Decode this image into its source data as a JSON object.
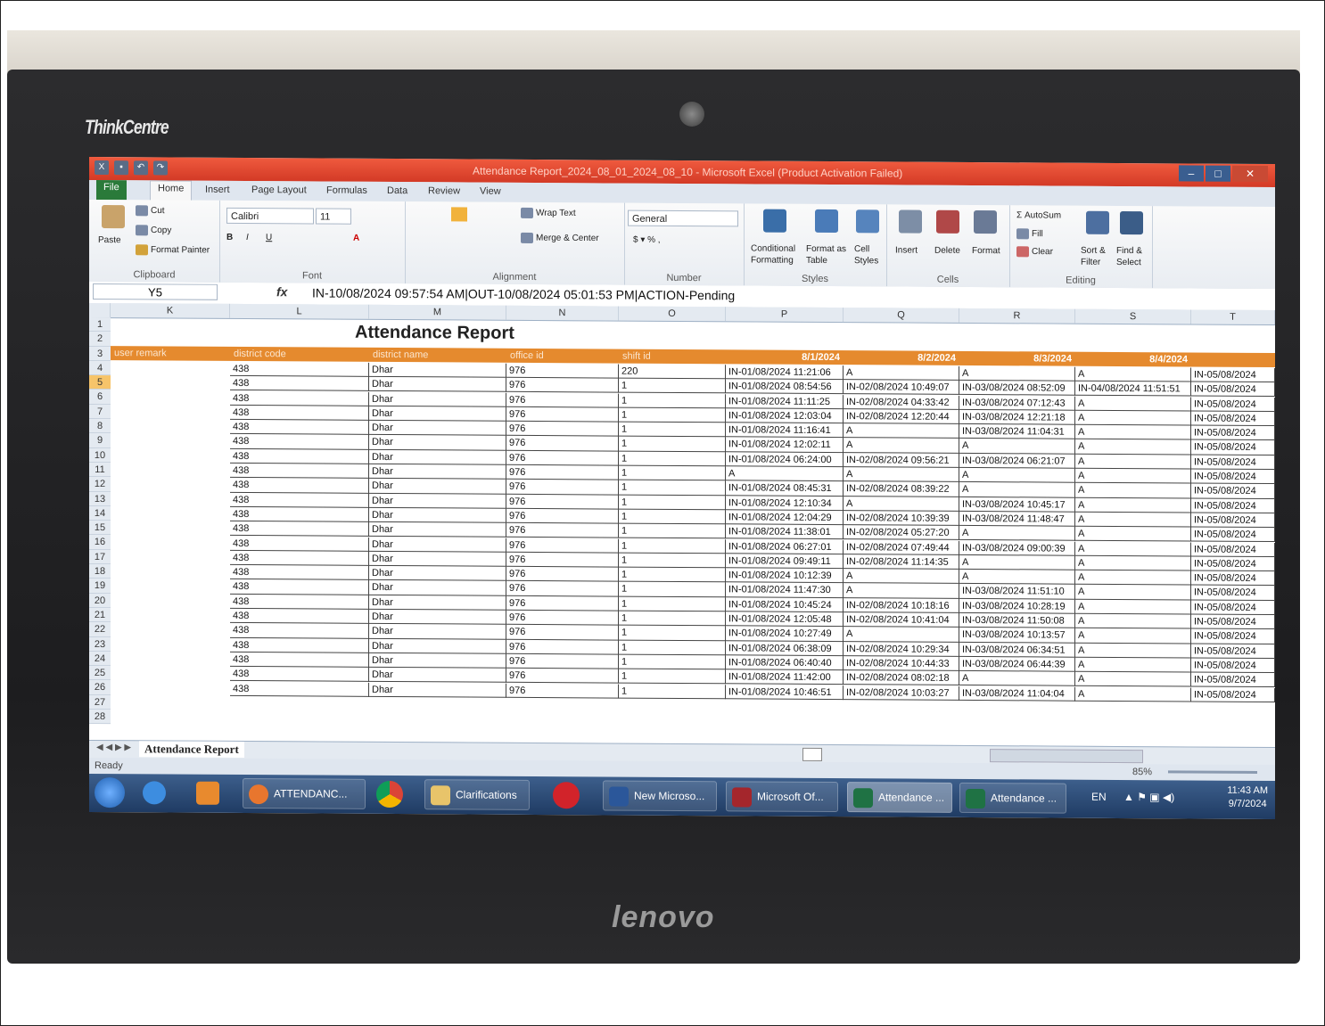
{
  "monitor": {
    "brand_top": "ThinkCentre",
    "brand_bottom": "lenovo"
  },
  "window": {
    "title": "Attendance Report_2024_08_01_2024_08_10 - Microsoft Excel (Product Activation Failed)"
  },
  "ribbon": {
    "tabs": [
      "File",
      "Home",
      "Insert",
      "Page Layout",
      "Formulas",
      "Data",
      "Review",
      "View"
    ],
    "clipboard": {
      "paste": "Paste",
      "cut": "Cut",
      "copy": "Copy",
      "format_painter": "Format Painter",
      "label": "Clipboard"
    },
    "font": {
      "name": "Calibri",
      "size": "11",
      "label": "Font"
    },
    "alignment": {
      "wrap_text": "Wrap Text",
      "merge_center": "Merge & Center",
      "label": "Alignment"
    },
    "number": {
      "format": "General",
      "label": "Number"
    },
    "styles": {
      "conditional": "Conditional",
      "formatting": "Formatting",
      "format_as": "Format as",
      "table": "Table",
      "cell": "Cell",
      "cell_styles": "Styles",
      "label": "Styles"
    },
    "cells": {
      "insert": "Insert",
      "delete": "Delete",
      "format": "Format",
      "label": "Cells"
    },
    "editing": {
      "autosum": "AutoSum",
      "fill": "Fill",
      "clear": "Clear",
      "sort": "Sort &",
      "filter": "Filter",
      "find": "Find &",
      "select": "Select",
      "label": "Editing"
    }
  },
  "formula_bar": {
    "name_box": "Y5",
    "fx": "fx",
    "value": "IN-10/08/2024 09:57:54 AM|OUT-10/08/2024 05:01:53 PM|ACTION-Pending"
  },
  "sheet": {
    "column_letters": [
      "K",
      "L",
      "M",
      "N",
      "O",
      "P",
      "Q",
      "R",
      "S",
      "T"
    ],
    "row_numbers": [
      "1",
      "2",
      "3",
      "4",
      "5",
      "6",
      "7",
      "8",
      "9",
      "10",
      "11",
      "12",
      "13",
      "14",
      "15",
      "16",
      "17",
      "18",
      "19",
      "20",
      "21",
      "22",
      "23",
      "24",
      "25",
      "26",
      "27",
      "28"
    ],
    "title": "Attendance Report",
    "headers": [
      "user remark",
      "district code",
      "district name",
      "office id",
      "shift id",
      "8/1/2024",
      "8/2/2024",
      "8/3/2024",
      "8/4/2024"
    ],
    "rows": [
      [
        "",
        "438",
        "Dhar",
        "976",
        "220",
        "IN-01/08/2024 11:21:06",
        "A",
        "A",
        "A",
        "IN-05/08/2024"
      ],
      [
        "",
        "438",
        "Dhar",
        "976",
        "1",
        "IN-01/08/2024 08:54:56",
        "IN-02/08/2024 10:49:07",
        "IN-03/08/2024 08:52:09",
        "IN-04/08/2024 11:51:51",
        "IN-05/08/2024"
      ],
      [
        "",
        "438",
        "Dhar",
        "976",
        "1",
        "IN-01/08/2024 11:11:25",
        "IN-02/08/2024 04:33:42",
        "IN-03/08/2024 07:12:43",
        "A",
        "IN-05/08/2024"
      ],
      [
        "",
        "438",
        "Dhar",
        "976",
        "1",
        "IN-01/08/2024 12:03:04",
        "IN-02/08/2024 12:20:44",
        "IN-03/08/2024 12:21:18",
        "A",
        "IN-05/08/2024"
      ],
      [
        "",
        "438",
        "Dhar",
        "976",
        "1",
        "IN-01/08/2024 11:16:41",
        "A",
        "IN-03/08/2024 11:04:31",
        "A",
        "IN-05/08/2024"
      ],
      [
        "",
        "438",
        "Dhar",
        "976",
        "1",
        "IN-01/08/2024 12:02:11",
        "A",
        "A",
        "A",
        "IN-05/08/2024"
      ],
      [
        "",
        "438",
        "Dhar",
        "976",
        "1",
        "IN-01/08/2024 06:24:00",
        "IN-02/08/2024 09:56:21",
        "IN-03/08/2024 06:21:07",
        "A",
        "IN-05/08/2024"
      ],
      [
        "",
        "438",
        "Dhar",
        "976",
        "1",
        "A",
        "A",
        "A",
        "A",
        "IN-05/08/2024"
      ],
      [
        "",
        "438",
        "Dhar",
        "976",
        "1",
        "IN-01/08/2024 08:45:31",
        "IN-02/08/2024 08:39:22",
        "A",
        "A",
        "IN-05/08/2024"
      ],
      [
        "",
        "438",
        "Dhar",
        "976",
        "1",
        "IN-01/08/2024 12:10:34",
        "A",
        "IN-03/08/2024 10:45:17",
        "A",
        "IN-05/08/2024"
      ],
      [
        "",
        "438",
        "Dhar",
        "976",
        "1",
        "IN-01/08/2024 12:04:29",
        "IN-02/08/2024 10:39:39",
        "IN-03/08/2024 11:48:47",
        "A",
        "IN-05/08/2024"
      ],
      [
        "",
        "438",
        "Dhar",
        "976",
        "1",
        "IN-01/08/2024 11:38:01",
        "IN-02/08/2024 05:27:20",
        "A",
        "A",
        "IN-05/08/2024"
      ],
      [
        "",
        "438",
        "Dhar",
        "976",
        "1",
        "IN-01/08/2024 06:27:01",
        "IN-02/08/2024 07:49:44",
        "IN-03/08/2024 09:00:39",
        "A",
        "IN-05/08/2024"
      ],
      [
        "",
        "438",
        "Dhar",
        "976",
        "1",
        "IN-01/08/2024 09:49:11",
        "IN-02/08/2024 11:14:35",
        "A",
        "A",
        "IN-05/08/2024"
      ],
      [
        "",
        "438",
        "Dhar",
        "976",
        "1",
        "IN-01/08/2024 10:12:39",
        "A",
        "A",
        "A",
        "IN-05/08/2024"
      ],
      [
        "",
        "438",
        "Dhar",
        "976",
        "1",
        "IN-01/08/2024 11:47:30",
        "A",
        "IN-03/08/2024 11:51:10",
        "A",
        "IN-05/08/2024"
      ],
      [
        "",
        "438",
        "Dhar",
        "976",
        "1",
        "IN-01/08/2024 10:45:24",
        "IN-02/08/2024 10:18:16",
        "IN-03/08/2024 10:28:19",
        "A",
        "IN-05/08/2024"
      ],
      [
        "",
        "438",
        "Dhar",
        "976",
        "1",
        "IN-01/08/2024 12:05:48",
        "IN-02/08/2024 10:41:04",
        "IN-03/08/2024 11:50:08",
        "A",
        "IN-05/08/2024"
      ],
      [
        "",
        "438",
        "Dhar",
        "976",
        "1",
        "IN-01/08/2024 10:27:49",
        "A",
        "IN-03/08/2024 10:13:57",
        "A",
        "IN-05/08/2024"
      ],
      [
        "",
        "438",
        "Dhar",
        "976",
        "1",
        "IN-01/08/2024 06:38:09",
        "IN-02/08/2024 10:29:34",
        "IN-03/08/2024 06:34:51",
        "A",
        "IN-05/08/2024"
      ],
      [
        "",
        "438",
        "Dhar",
        "976",
        "1",
        "IN-01/08/2024 06:40:40",
        "IN-02/08/2024 10:44:33",
        "IN-03/08/2024 06:44:39",
        "A",
        "IN-05/08/2024"
      ],
      [
        "",
        "438",
        "Dhar",
        "976",
        "1",
        "IN-01/08/2024 11:42:00",
        "IN-02/08/2024 08:02:18",
        "A",
        "A",
        "IN-05/08/2024"
      ],
      [
        "",
        "438",
        "Dhar",
        "976",
        "1",
        "IN-01/08/2024 10:46:51",
        "IN-02/08/2024 10:03:27",
        "IN-03/08/2024 11:04:04",
        "A",
        "IN-05/08/2024"
      ]
    ],
    "tab_name": "Attendance Report"
  },
  "status_bar": {
    "text": "Ready",
    "zoom": "85%"
  },
  "taskbar": {
    "items": [
      "ATTENDANC...",
      "Clarifications",
      "New Microso...",
      "Microsoft Of...",
      "Attendance ...",
      "Attendance ..."
    ],
    "lang": "EN",
    "time": "11:43 AM",
    "date": "9/7/2024"
  },
  "colors": {
    "title_bar": "#d33a26",
    "header_row": "#e58a2e",
    "selected_row": "#f6c46a",
    "taskbar": "#1f3b63"
  }
}
